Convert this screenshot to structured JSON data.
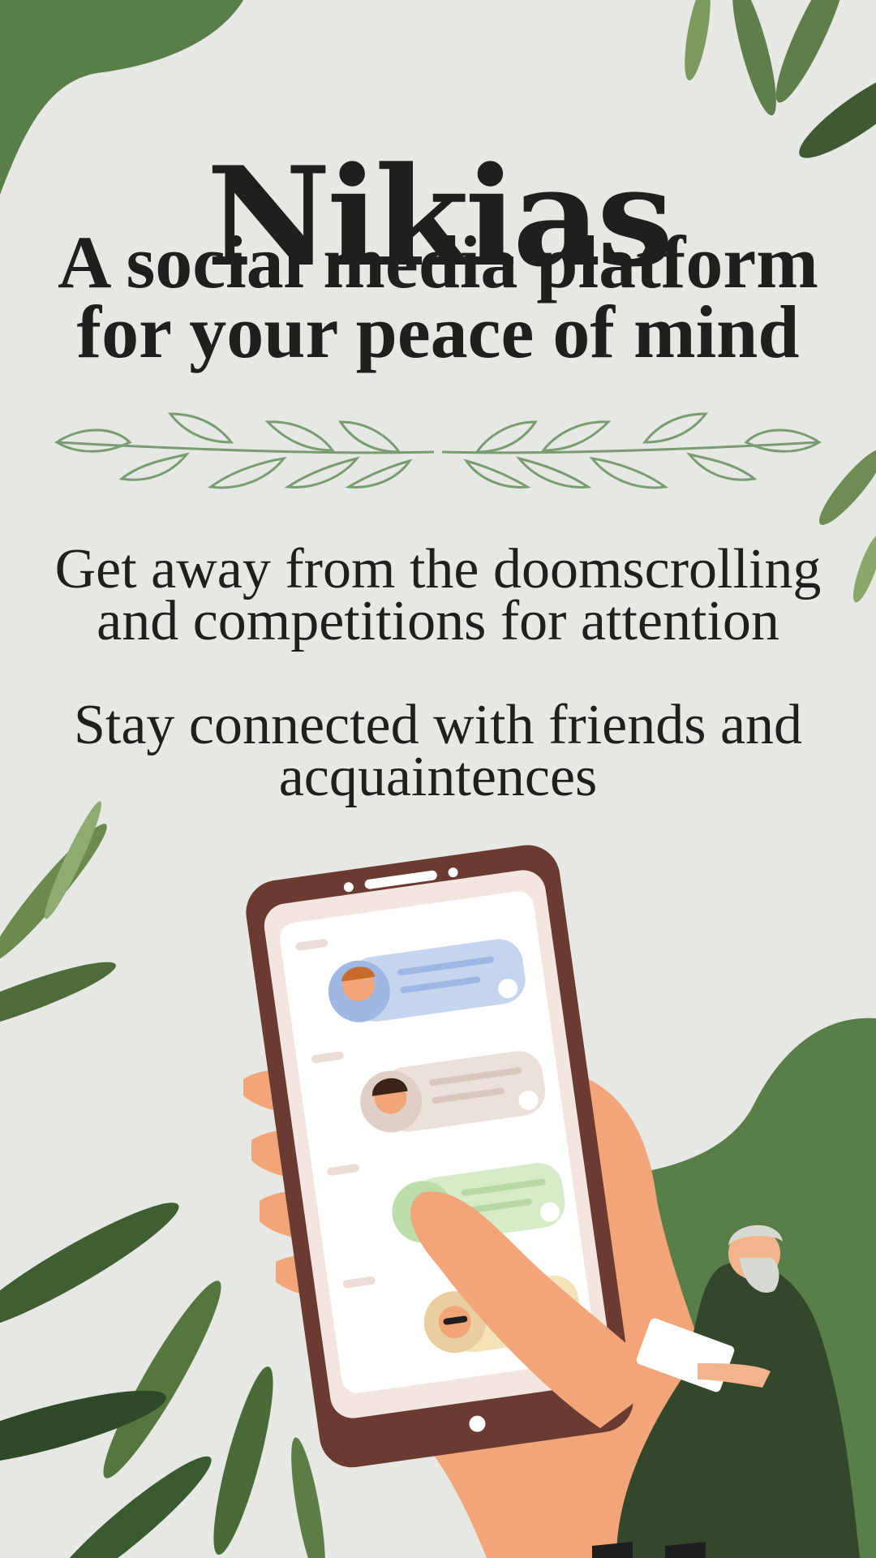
{
  "brand": {
    "title": "Nikias"
  },
  "tagline": {
    "lines": [
      "A social media platform",
      "for your peace of mind"
    ]
  },
  "descriptions": [
    {
      "lines": [
        "Get away from the doomscrolling",
        "and competitions for attention"
      ]
    },
    {
      "lines": [
        "Stay connected with friends and",
        "acquaintences"
      ]
    }
  ],
  "colors": {
    "background": "#e6e8e3",
    "accent_green": "#5a7e48",
    "laurel_green": "#7a9c72",
    "text": "#1f1f1f",
    "phone_body": "#6b3a30",
    "skin": "#f2a579"
  },
  "illustration": {
    "icons": [
      "laurel-divider-icon",
      "phone-icon",
      "hand-icon",
      "philosopher-icon",
      "olive-leaves-icon"
    ],
    "chat_bubble_colors": [
      "#c6d5ef",
      "#ece0da",
      "#d6ecc8",
      "#f4e2b8"
    ]
  }
}
